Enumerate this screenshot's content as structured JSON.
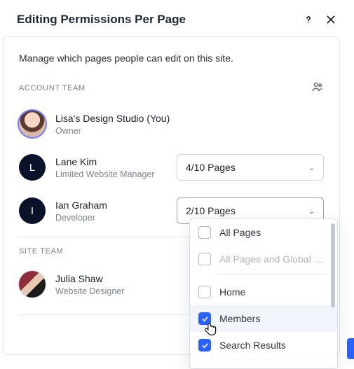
{
  "header": {
    "title": "Editing Permissions Per Page"
  },
  "description": "Manage which pages people can edit on this site.",
  "sections": {
    "account_team_label": "ACCOUNT TEAM",
    "site_team_label": "SITE TEAM"
  },
  "account_team": [
    {
      "name": "Lisa's Design Studio (You)",
      "role": "Owner",
      "initial": ""
    },
    {
      "name": "Lane Kim",
      "role": "Limited Website Manager",
      "initial": "L",
      "pages_summary": "4/10 Pages"
    },
    {
      "name": "Ian Graham",
      "role": "Developer",
      "initial": "I",
      "pages_summary": "2/10 Pages"
    }
  ],
  "site_team": [
    {
      "name": "Julia Shaw",
      "role": "Website Designer",
      "initial": ""
    }
  ],
  "page_options": [
    {
      "label": "All Pages",
      "checked": false,
      "disabled": false
    },
    {
      "label": "All Pages and Global Se…",
      "checked": false,
      "disabled": true
    },
    {
      "label": "Home",
      "checked": false,
      "disabled": false
    },
    {
      "label": "Members",
      "checked": true,
      "disabled": false,
      "highlight": true
    },
    {
      "label": "Search Results",
      "checked": true,
      "disabled": false
    }
  ]
}
